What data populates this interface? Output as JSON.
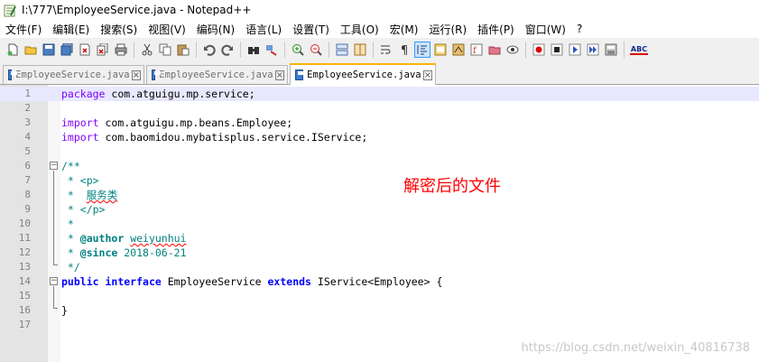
{
  "window": {
    "title": "I:\\777\\EmployeeService.java - Notepad++"
  },
  "menu": {
    "items": [
      "文件(F)",
      "编辑(E)",
      "搜索(S)",
      "视图(V)",
      "编码(N)",
      "语言(L)",
      "设置(T)",
      "工具(O)",
      "宏(M)",
      "运行(R)",
      "插件(P)",
      "窗口(W)",
      "?"
    ]
  },
  "toolbar": {
    "icons": [
      "new-file-icon",
      "open-file-icon",
      "save-icon",
      "save-all-icon",
      "close-icon",
      "close-all-icon",
      "print-icon",
      "cut-icon",
      "copy-icon",
      "paste-icon",
      "undo-icon",
      "redo-icon",
      "find-icon",
      "replace-icon",
      "zoom-in-icon",
      "zoom-out-icon",
      "sync-vertical-icon",
      "sync-horizontal-icon",
      "word-wrap-icon",
      "show-all-chars-icon",
      "indent-guide-icon",
      "udl-icon",
      "doc-map-icon",
      "function-list-icon",
      "folder-workspace-icon",
      "monitor-icon",
      "record-macro-icon",
      "stop-record-icon",
      "play-macro-icon",
      "run-macro-multiple-icon",
      "save-macro-icon",
      "spell-check-icon"
    ],
    "spellcheck_label": "ABC"
  },
  "tabs": [
    {
      "label": "EmployeeService.java",
      "active": false
    },
    {
      "label": "EmployeeService.java",
      "active": false
    },
    {
      "label": "EmployeeService.java",
      "active": true
    }
  ],
  "editor": {
    "line_numbers": [
      "1",
      "2",
      "3",
      "4",
      "5",
      "6",
      "7",
      "8",
      "9",
      "10",
      "11",
      "12",
      "13",
      "14",
      "15",
      "16",
      "17"
    ],
    "lines": {
      "l1_kw": "package",
      "l1_rest": " com.atguigu.mp.service;",
      "l3_kw": "import",
      "l3_rest": " com.atguigu.mp.beans.Employee;",
      "l4_kw": "import",
      "l4_rest": " com.baomidou.mybatisplus.service.IService;",
      "l6": "/**",
      "l7_pre": " * ",
      "l7_tag": "<p>",
      "l8_pre": " *  ",
      "l8_text": "服务类",
      "l9_pre": " * ",
      "l9_tag": "</p>",
      "l10": " *",
      "l11_pre": " * ",
      "l11_tag": "@author",
      "l11_sp": " ",
      "l11_name": "weiyunhui",
      "l12_pre": " * ",
      "l12_tag": "@since",
      "l12_rest": " 2018-06-21",
      "l13": " */",
      "l14_kw1": "public",
      "l14_sp1": " ",
      "l14_kw2": "interface",
      "l14_mid": " EmployeeService ",
      "l14_kw3": "extends",
      "l14_rest": " IService<Employee> {",
      "l16": "}"
    }
  },
  "annotation": "解密后的文件",
  "watermark": "https://blog.csdn.net/weixin_40816738"
}
